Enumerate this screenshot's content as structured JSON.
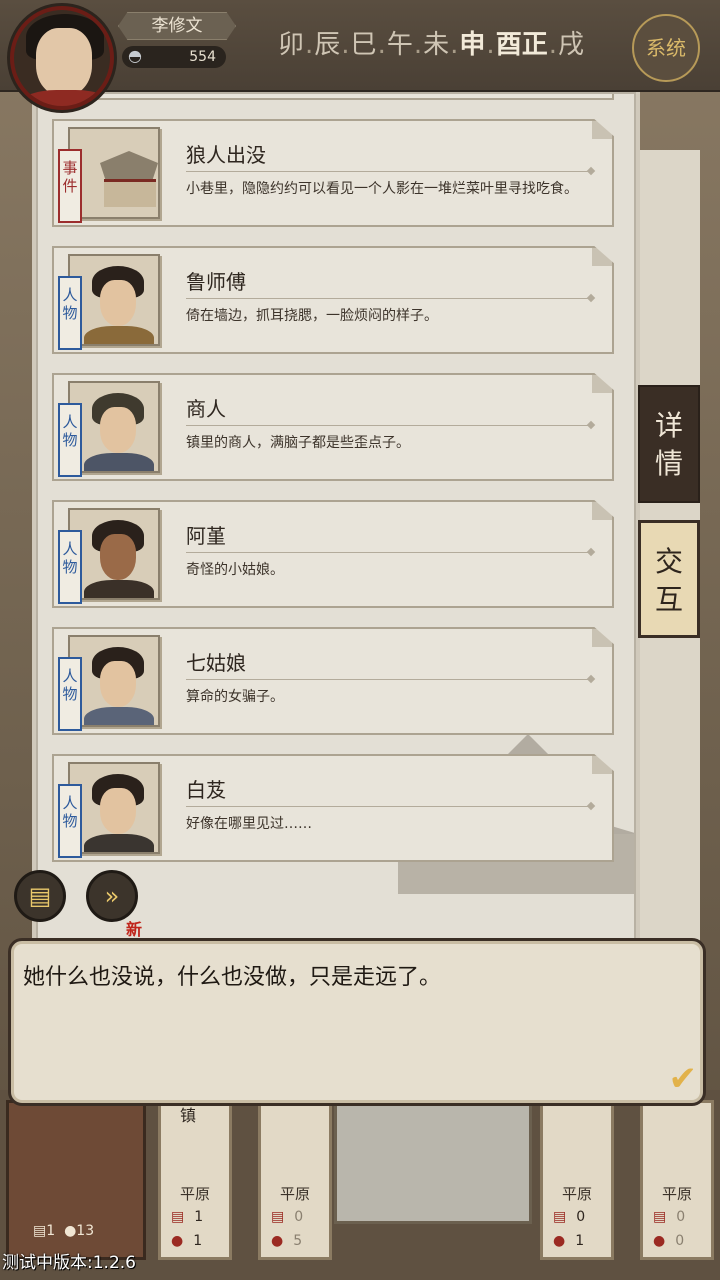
{
  "player": {
    "name": "李修文",
    "silver": "554"
  },
  "time_bar": {
    "hours": [
      "卯",
      "辰",
      "巳",
      "午",
      "未",
      "申",
      "酉",
      "正",
      "戌"
    ],
    "active_hours": [
      "申",
      "酉",
      "正"
    ]
  },
  "system_button": "系统",
  "side_tabs": {
    "detail": "详情",
    "interact": "交互"
  },
  "cards": [
    {
      "tag": "事件",
      "type": "event",
      "title": "狼人出没",
      "desc": "小巷里，隐隐约约可以看见一个人影在一堆烂菜叶里寻找吃食。"
    },
    {
      "tag": "人物",
      "type": "person",
      "title": "鲁师傅",
      "desc": "倚在墙边，抓耳挠腮，一脸烦闷的样子。"
    },
    {
      "tag": "人物",
      "type": "person",
      "title": "商人",
      "desc": "镇里的商人，满脑子都是些歪点子。"
    },
    {
      "tag": "人物",
      "type": "person",
      "title": "阿堇",
      "desc": "奇怪的小姑娘。"
    },
    {
      "tag": "人物",
      "type": "person",
      "title": "七姑娘",
      "desc": "算命的女骗子。"
    },
    {
      "tag": "人物",
      "type": "person",
      "title": "白芨",
      "desc": "好像在哪里见过……"
    }
  ],
  "new_badge": "新",
  "dialog": {
    "text": "她什么也没说，什么也没做，只是走远了。"
  },
  "map_tiles": [
    {
      "name": "平原",
      "scrolls": "1",
      "people": "1"
    },
    {
      "name": "平原",
      "scrolls": "0",
      "people": "5"
    },
    {
      "name": "平原",
      "scrolls": "0",
      "people": "1"
    },
    {
      "name": "平原",
      "scrolls": "0",
      "people": "0"
    }
  ],
  "big_tile": {
    "scrolls": "1",
    "people": "13"
  },
  "town_partial": "镇",
  "version": "测试中版本:1.2.6"
}
